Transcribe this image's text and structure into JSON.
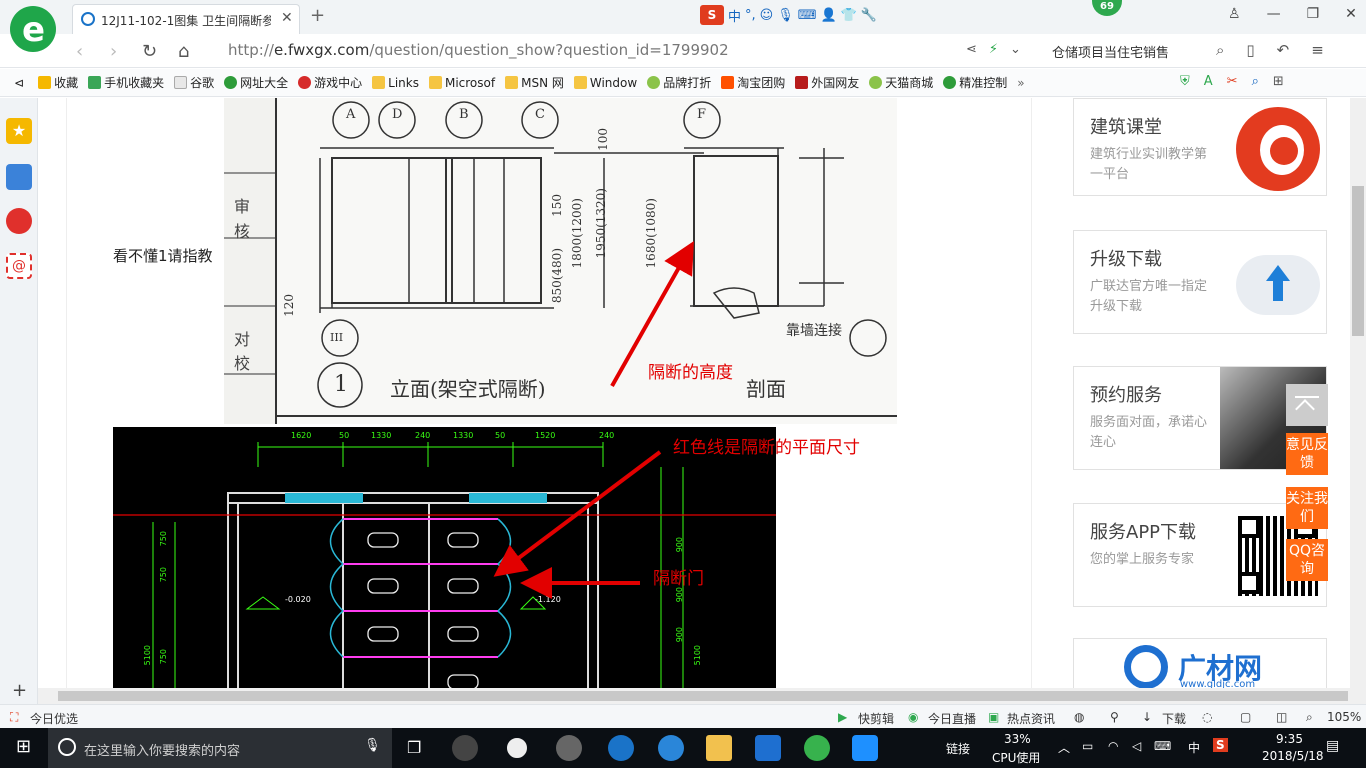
{
  "browser": {
    "tab_title": "12J11-102-1图集 卫生间隔断参",
    "url_domain": "e.fwxgx.com",
    "url_prefix": "http://",
    "url_path": "/question/question_show?question_id=1799902",
    "search_text": "仓储项目当住宅销售",
    "badge_count": "69",
    "tools_s": "S",
    "tools_zh": "中"
  },
  "bookmarks": [
    {
      "label": "收藏",
      "color": "#f5b800"
    },
    {
      "label": "手机收藏夹",
      "color": "#3aa657"
    },
    {
      "label": "谷歌",
      "color": "#e8e8e8"
    },
    {
      "label": "网址大全",
      "color": "#2e9c3a"
    },
    {
      "label": "游戏中心",
      "color": "#d62b2b"
    },
    {
      "label": "Links",
      "color": "#f5c542"
    },
    {
      "label": "Microsof",
      "color": "#f5c542"
    },
    {
      "label": "MSN 网",
      "color": "#f5c542"
    },
    {
      "label": "Window",
      "color": "#f5c542"
    },
    {
      "label": "品牌打折",
      "color": "#8bc34a"
    },
    {
      "label": "淘宝团购",
      "color": "#ff5000"
    },
    {
      "label": "外国网友",
      "color": "#b71c1c"
    },
    {
      "label": "天猫商城",
      "color": "#8bc34a"
    },
    {
      "label": "精准控制",
      "color": "#2e9c3a"
    }
  ],
  "content": {
    "question_text": "看不懂1请指教",
    "annotations": {
      "height": "隔断的高度",
      "plan": "红色线是隔断的平面尺寸",
      "door": "隔断门"
    },
    "drawing1": {
      "caption_num": "1",
      "caption": "立面(架空式隔断)",
      "section": "剖面",
      "wall_note": "靠墙连接",
      "callouts": [
        "A",
        "D",
        "B",
        "C",
        "F"
      ],
      "dims": [
        "150",
        "850(480)",
        "1800(1200)",
        "1950(1320)",
        "1680(1080)",
        "120",
        "100"
      ],
      "side_labels": [
        "审",
        "核",
        "对",
        "校"
      ],
      "ref": "III"
    },
    "drawing2": {
      "top_dims": [
        "1620",
        "50",
        "1330",
        "240",
        "1330",
        "50",
        "1520",
        "240"
      ],
      "left_dims": [
        "750",
        "750",
        "750",
        "5100"
      ],
      "right_dims": [
        "900",
        "900",
        "900",
        "5100"
      ],
      "level1": "-0.020",
      "level2": "-1.120"
    }
  },
  "cards": [
    {
      "title": "建筑课堂",
      "desc": "建筑行业实训教学第一平台",
      "color": "#e33b1f"
    },
    {
      "title": "升级下载",
      "desc": "广联达官方唯一指定升级下载",
      "color": "#1e7fd8"
    },
    {
      "title": "预约服务",
      "desc": "服务面对面，承诺心连心",
      "color": "#333"
    },
    {
      "title": "服务APP下载",
      "desc": "您的掌上服务专家",
      "color": "#000"
    },
    {
      "title": "广材网",
      "desc": "www.gldjc.com",
      "color": "#1e6fd0"
    }
  ],
  "float_buttons": [
    "意见反馈",
    "关注我们",
    "QQ咨询"
  ],
  "status": {
    "left": "今日优选",
    "items": [
      "快剪辑",
      "今日直播",
      "热点资讯",
      "下载"
    ],
    "zoom": "105%"
  },
  "taskbar": {
    "search_placeholder": "在这里输入你要搜索的内容",
    "link": "链接",
    "cpu_pct": "33%",
    "cpu_label": "CPU使用",
    "ime": "中",
    "time": "9:35",
    "date": "2018/5/18"
  }
}
